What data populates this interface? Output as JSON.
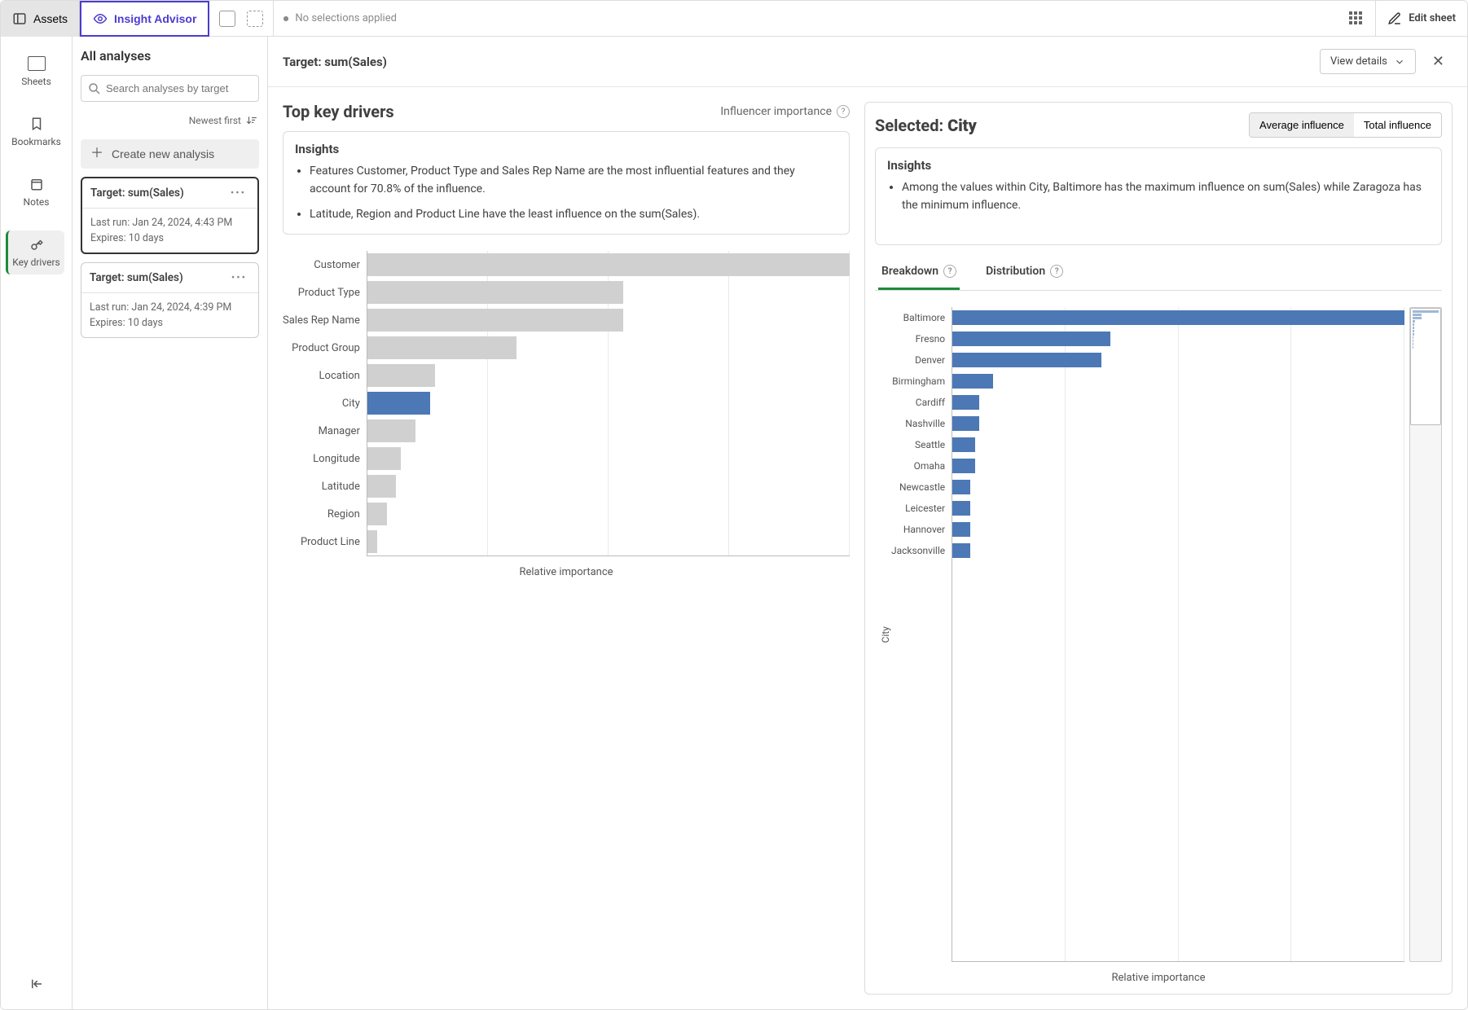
{
  "topbar": {
    "assets_label": "Assets",
    "insight_label": "Insight Advisor",
    "no_selections": "No selections applied",
    "edit_sheet": "Edit sheet"
  },
  "rail": {
    "sheets": "Sheets",
    "bookmarks": "Bookmarks",
    "notes": "Notes",
    "keydrivers": "Key drivers"
  },
  "panel": {
    "title": "All analyses",
    "search_placeholder": "Search analyses by target",
    "sort_label": "Newest first",
    "create_label": "Create new analysis",
    "cards": [
      {
        "title": "Target: sum(Sales)",
        "last_run": "Last run: Jan 24, 2024, 4:43 PM",
        "expires": "Expires: 10 days"
      },
      {
        "title": "Target: sum(Sales)",
        "last_run": "Last run: Jan 24, 2024, 4:39 PM",
        "expires": "Expires: 10 days"
      }
    ]
  },
  "main": {
    "target_label": "Target: sum(Sales)",
    "view_details": "View details",
    "left": {
      "title": "Top key drivers",
      "infl_label": "Influencer importance",
      "insights_title": "Insights",
      "insights": [
        "Features Customer, Product Type and Sales Rep Name are the most influential features and they account for 70.8% of the influence.",
        "Latitude, Region and Product Line have the least influence on the sum(Sales)."
      ],
      "xlabel": "Relative importance"
    },
    "right": {
      "selected_prefix": "Selected: ",
      "selected_value": "City",
      "avg_label": "Average influence",
      "total_label": "Total influence",
      "insights_title": "Insights",
      "insights": [
        "Among the values within City, Baltimore has the maximum influence on sum(Sales) while Zaragoza has the minimum influence."
      ],
      "tab_breakdown": "Breakdown",
      "tab_distribution": "Distribution",
      "axis_title": "City",
      "xlabel": "Relative importance"
    }
  },
  "chart_data": [
    {
      "type": "bar",
      "orientation": "horizontal",
      "title": "Top key drivers",
      "xlabel": "Relative importance",
      "ylabel": "",
      "categories": [
        "Customer",
        "Product Type",
        "Sales Rep Name",
        "Product Group",
        "Location",
        "City",
        "Manager",
        "Longitude",
        "Latitude",
        "Region",
        "Product Line"
      ],
      "values": [
        100,
        53,
        53,
        31,
        14,
        13,
        10,
        7,
        6,
        4,
        2
      ],
      "selected": "City"
    },
    {
      "type": "bar",
      "orientation": "horizontal",
      "title": "Breakdown by City",
      "xlabel": "Relative importance",
      "ylabel": "City",
      "categories": [
        "Baltimore",
        "Fresno",
        "Denver",
        "Birmingham",
        "Cardiff",
        "Nashville",
        "Seattle",
        "Omaha",
        "Newcastle",
        "Leicester",
        "Hannover",
        "Jacksonville"
      ],
      "values": [
        100,
        35,
        33,
        9,
        6,
        6,
        5,
        5,
        4,
        4,
        4,
        4
      ]
    }
  ]
}
